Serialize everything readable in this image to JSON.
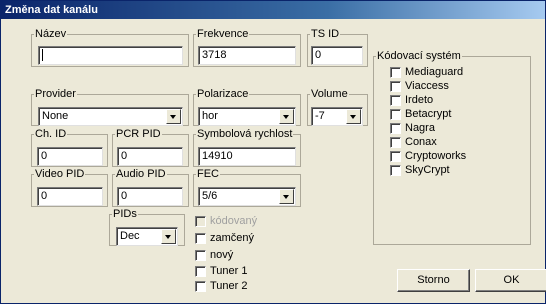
{
  "window": {
    "title": "Změna dat kanálu"
  },
  "fields": {
    "nazev": {
      "label": "Název",
      "value": ""
    },
    "frekvence": {
      "label": "Frekvence",
      "value": "3718"
    },
    "tsid": {
      "label": "TS ID",
      "value": "0"
    },
    "provider": {
      "label": "Provider",
      "value": "None"
    },
    "polarizace": {
      "label": "Polarizace",
      "value": "hor"
    },
    "volume": {
      "label": "Volume",
      "value": "-7"
    },
    "chid": {
      "label": "Ch. ID",
      "value": "0"
    },
    "pcrpid": {
      "label": "PCR PID",
      "value": "0"
    },
    "symbolova": {
      "label": "Symbolová rychlost",
      "value": "14910"
    },
    "videopid": {
      "label": "Video PID",
      "value": "0"
    },
    "audiopid": {
      "label": "Audio PID",
      "value": "0"
    },
    "fec": {
      "label": "FEC",
      "value": "5/6"
    },
    "pids": {
      "label": "PIDs",
      "value": "Dec"
    }
  },
  "kodovaci": {
    "label": "Kódovací systém",
    "items": [
      "Mediaguard",
      "Viaccess",
      "Irdeto",
      "Betacrypt",
      "Nagra",
      "Conax",
      "Cryptoworks",
      "SkyCrypt"
    ]
  },
  "options": {
    "kodovany": "kódovaný",
    "zamceny": "zamčený",
    "novy": "nový",
    "tuner1": "Tuner 1",
    "tuner2": "Tuner 2"
  },
  "buttons": {
    "storno": "Storno",
    "ok": "OK"
  }
}
